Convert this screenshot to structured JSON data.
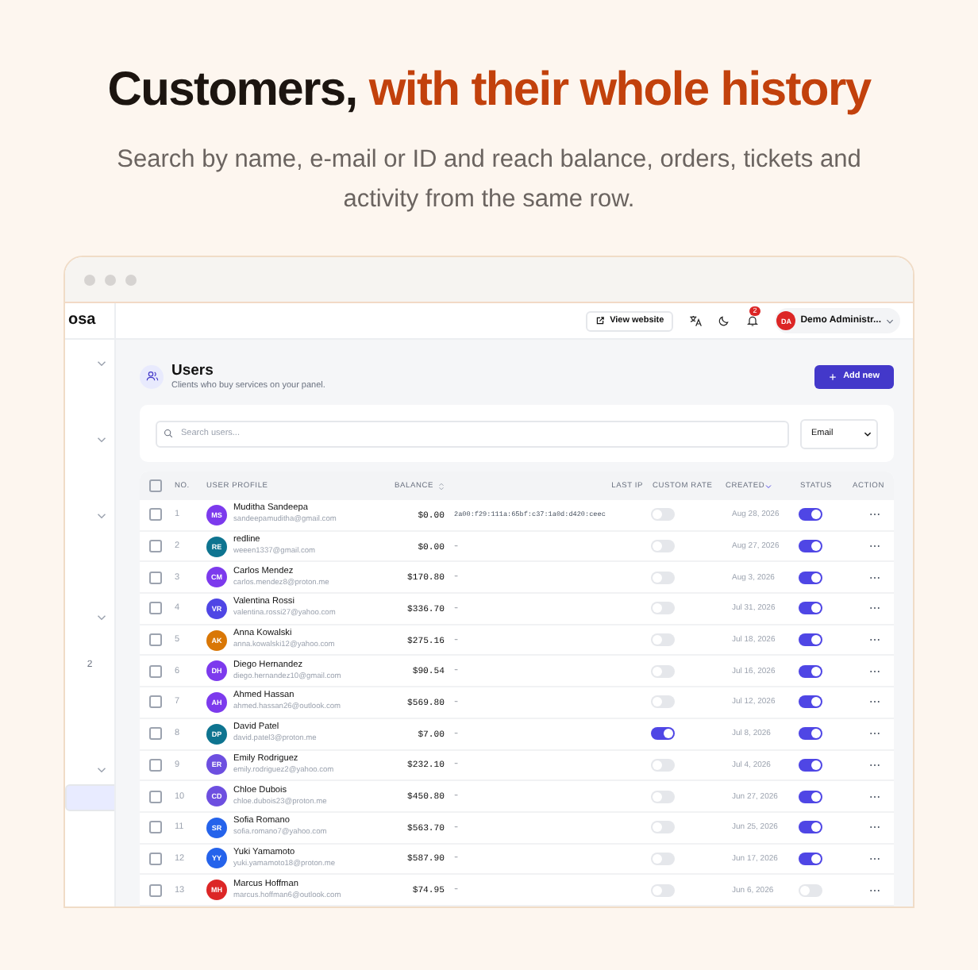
{
  "hero": {
    "title_dark": "Customers,",
    "title_accent": "with their whole history",
    "subtitle": "Search by name, e-mail or ID and reach balance, orders, tickets and activity from the same row."
  },
  "sidebar": {
    "logo": "osa",
    "items": [
      {
        "kind": "group",
        "selected": false
      },
      {
        "kind": "group",
        "selected": false
      },
      {
        "kind": "group",
        "selected": false
      },
      {
        "kind": "group",
        "selected": false
      },
      {
        "kind": "count",
        "text": "2",
        "selected": false
      },
      {
        "kind": "group",
        "selected": false
      },
      {
        "kind": "link",
        "selected": true
      }
    ]
  },
  "topbar": {
    "view_website": "View website",
    "notifications": "2",
    "user_initials": "DA",
    "user_name": "Demo Administr..."
  },
  "page": {
    "title": "Users",
    "subtitle": "Clients who buy services on your panel.",
    "add_button": "Add new"
  },
  "search": {
    "placeholder": "Search users...",
    "filter": "Email"
  },
  "table": {
    "select_all": {
      "checked": false
    },
    "columns": [
      "NO.",
      "USER PROFILE",
      "BALANCE",
      "LAST IP",
      "CUSTOM RATE",
      "CREATED",
      "STATUS",
      "ACTION"
    ],
    "rows": [
      {
        "no": "1",
        "initials": "MS",
        "color": "#7c3aed",
        "name": "Muditha Sandeepa",
        "email": "sandeepamuditha@gmail.com",
        "balance": "$0.00",
        "last_ip": "2a00:f29:111a:65bf:c37:1a0d:d420:ceec",
        "custom_rate": false,
        "created": "Aug 28, 2026",
        "status": true,
        "checked": false
      },
      {
        "no": "2",
        "initials": "RE",
        "color": "#0e7490",
        "name": "redline",
        "email": "weeen1337@gmail.com",
        "balance": "$0.00",
        "last_ip": "–",
        "custom_rate": false,
        "created": "Aug 27, 2026",
        "status": true,
        "checked": false
      },
      {
        "no": "3",
        "initials": "CM",
        "color": "#7c3aed",
        "name": "Carlos Mendez",
        "email": "carlos.mendez8@proton.me",
        "balance": "$170.80",
        "last_ip": "–",
        "custom_rate": false,
        "created": "Aug 3, 2026",
        "status": true,
        "checked": false
      },
      {
        "no": "4",
        "initials": "VR",
        "color": "#4f46e5",
        "name": "Valentina Rossi",
        "email": "valentina.rossi27@yahoo.com",
        "balance": "$336.70",
        "last_ip": "–",
        "custom_rate": false,
        "created": "Jul 31, 2026",
        "status": true,
        "checked": false
      },
      {
        "no": "5",
        "initials": "AK",
        "color": "#d97706",
        "name": "Anna Kowalski",
        "email": "anna.kowalski12@yahoo.com",
        "balance": "$275.16",
        "last_ip": "–",
        "custom_rate": false,
        "created": "Jul 18, 2026",
        "status": true,
        "checked": false
      },
      {
        "no": "6",
        "initials": "DH",
        "color": "#7c3aed",
        "name": "Diego Hernandez",
        "email": "diego.hernandez10@gmail.com",
        "balance": "$90.54",
        "last_ip": "–",
        "custom_rate": false,
        "created": "Jul 16, 2026",
        "status": true,
        "checked": false
      },
      {
        "no": "7",
        "initials": "AH",
        "color": "#7c3aed",
        "name": "Ahmed Hassan",
        "email": "ahmed.hassan26@outlook.com",
        "balance": "$569.80",
        "last_ip": "–",
        "custom_rate": false,
        "created": "Jul 12, 2026",
        "status": true,
        "checked": false
      },
      {
        "no": "8",
        "initials": "DP",
        "color": "#0e7490",
        "name": "David Patel",
        "email": "david.patel3@proton.me",
        "balance": "$7.00",
        "last_ip": "–",
        "custom_rate": true,
        "created": "Jul 8, 2026",
        "status": true,
        "checked": false
      },
      {
        "no": "9",
        "initials": "ER",
        "color": "#6d4fe0",
        "name": "Emily Rodriguez",
        "email": "emily.rodriguez2@yahoo.com",
        "balance": "$232.10",
        "last_ip": "–",
        "custom_rate": false,
        "created": "Jul 4, 2026",
        "status": true,
        "checked": false
      },
      {
        "no": "10",
        "initials": "CD",
        "color": "#6d4fe0",
        "name": "Chloe Dubois",
        "email": "chloe.dubois23@proton.me",
        "balance": "$450.80",
        "last_ip": "–",
        "custom_rate": false,
        "created": "Jun 27, 2026",
        "status": true,
        "checked": false
      },
      {
        "no": "11",
        "initials": "SR",
        "color": "#2563eb",
        "name": "Sofia Romano",
        "email": "sofia.romano7@yahoo.com",
        "balance": "$563.70",
        "last_ip": "–",
        "custom_rate": false,
        "created": "Jun 25, 2026",
        "status": true,
        "checked": false
      },
      {
        "no": "12",
        "initials": "YY",
        "color": "#2563eb",
        "name": "Yuki Yamamoto",
        "email": "yuki.yamamoto18@proton.me",
        "balance": "$587.90",
        "last_ip": "–",
        "custom_rate": false,
        "created": "Jun 17, 2026",
        "status": true,
        "checked": false
      },
      {
        "no": "13",
        "initials": "MH",
        "color": "#dc2626",
        "name": "Marcus Hoffman",
        "email": "marcus.hoffman6@outlook.com",
        "balance": "$74.95",
        "last_ip": "–",
        "custom_rate": false,
        "created": "Jun 6, 2026",
        "status": false,
        "checked": false
      }
    ]
  }
}
